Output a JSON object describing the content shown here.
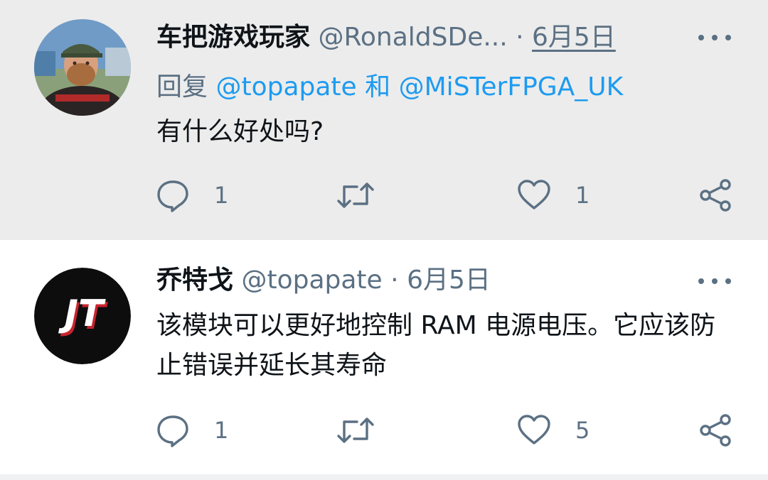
{
  "tweets": [
    {
      "name": "车把游戏玩家",
      "handle": "@RonaldSDe...",
      "separator": "·",
      "date": "6月5日",
      "replying": {
        "prefix": "回复",
        "mention1": "@topapate",
        "conj": "和",
        "mention2": "@MiSTerFPGA_UK"
      },
      "text": "有什么好处吗?",
      "reply_count": "1",
      "retweet_count": "",
      "like_count": "1",
      "avatar_icon": "user-photo-avatar"
    },
    {
      "name": "乔特戈",
      "handle": "@topapate",
      "separator": "·",
      "date": "6月5日",
      "avatar_text": "JT",
      "text": "该模块可以更好地控制 RAM 电源电压。它应该防止错误并延长其寿命",
      "reply_count": "1",
      "retweet_count": "",
      "like_count": "5",
      "avatar_icon": "jt-logo-avatar"
    }
  ],
  "icons": {
    "reply": "comment-bubble-icon",
    "retweet": "retweet-icon",
    "like": "heart-icon",
    "share": "share-icon",
    "more": "more-dots-icon"
  },
  "colors": {
    "link": "#1d9bf0",
    "muted": "#5b7083",
    "text": "#0f1419",
    "highlight_bg": "#ececec",
    "thread_line": "#c9d1d8"
  }
}
